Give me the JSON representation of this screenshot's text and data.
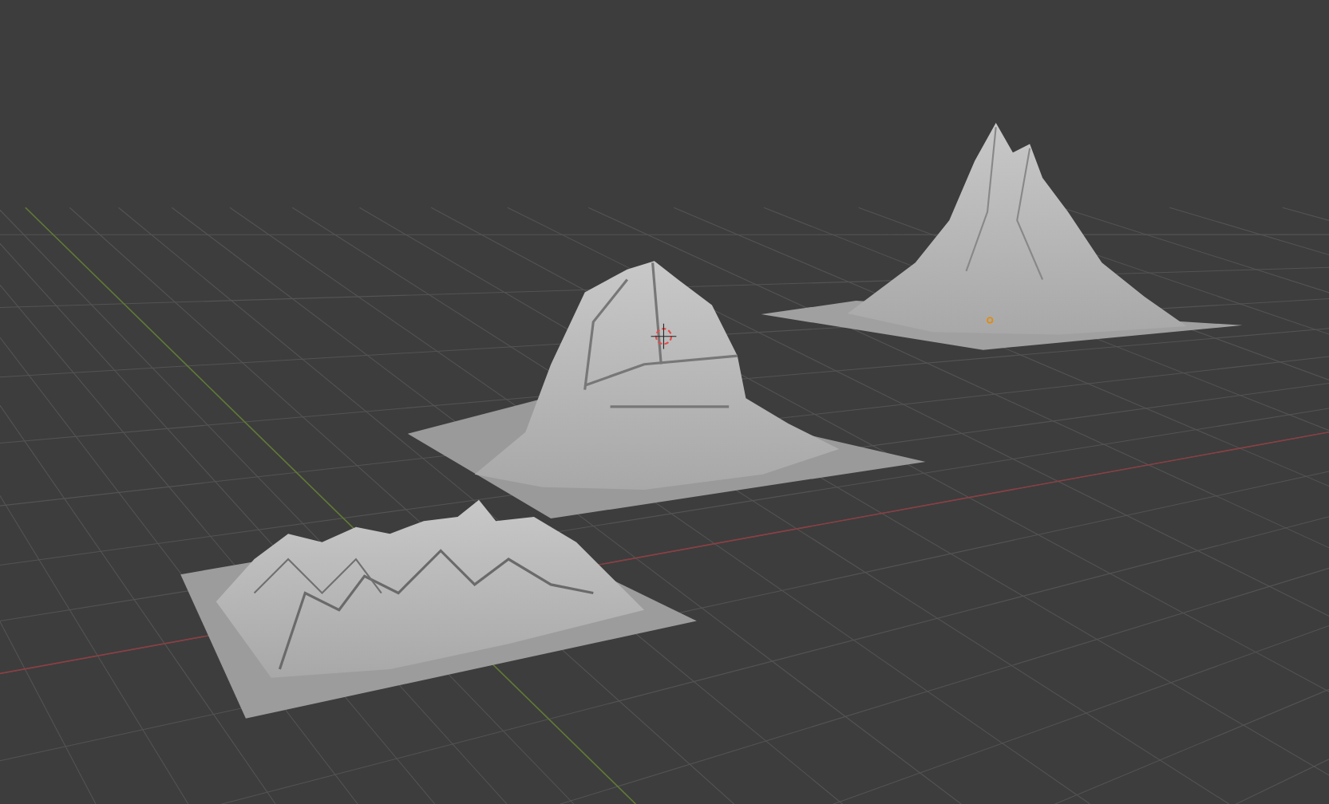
{
  "viewport": {
    "objects": [
      {
        "kind": "range"
      },
      {
        "kind": "dome"
      },
      {
        "kind": "peak"
      }
    ],
    "cursor_shown": true,
    "origin_shown": true
  }
}
